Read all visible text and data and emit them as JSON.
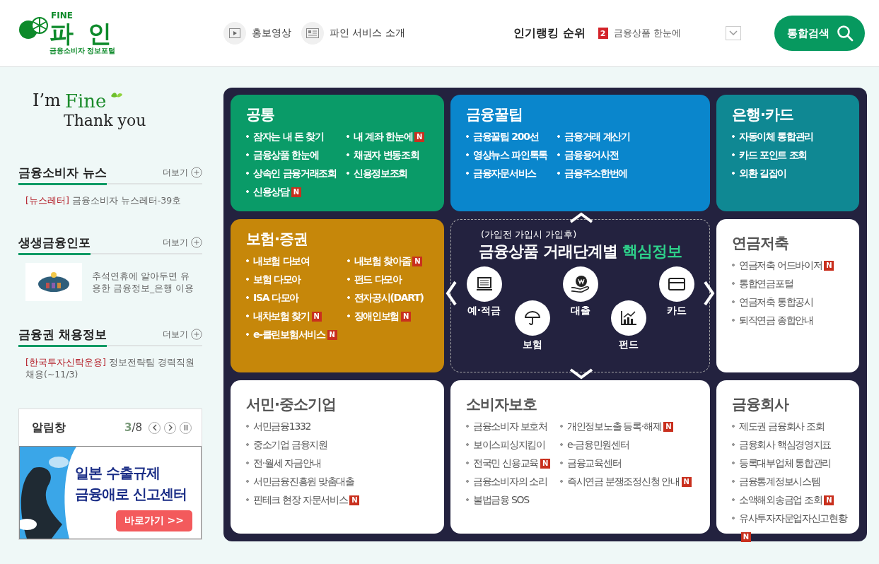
{
  "header": {
    "logo": {
      "top": "FINE",
      "name": "파 인",
      "sub": "금융소비자 정보포털"
    },
    "nav": [
      {
        "label": "홍보영상",
        "kind": "video"
      },
      {
        "label": "파인 서비스 소개",
        "kind": "doc"
      }
    ],
    "ranking": {
      "label": "인기랭킹 순위",
      "rank": "2",
      "text": "금융상품 한눈에"
    },
    "search_button": "통합검색"
  },
  "sidebar": {
    "slogan": {
      "first": "I’m",
      "accent": "Fine",
      "second": "Thank you"
    },
    "sections": [
      {
        "title": "금융소비자 뉴스",
        "more": "더보기",
        "kind": "tagged",
        "tag": "[뉴스레터]",
        "text": "금융소비자 뉴스레터-39호"
      },
      {
        "title": "생생금융인포",
        "more": "더보기",
        "kind": "thumb",
        "text": "추석연휴에 알아두면 유용한 금융정보_은행 이용"
      },
      {
        "title": "금융권 채용정보",
        "more": "더보기",
        "kind": "tagged",
        "tag": "[한국투자신탁운용]",
        "text": "정보전략팀 경력직원 채용(~11/3)"
      }
    ],
    "notice": {
      "title": "알림창",
      "current": "3",
      "total": "/8",
      "banner_lines": [
        "일본 수출규제",
        "금융애로 신고센터"
      ],
      "banner_button": "바로가기 >>"
    }
  },
  "cards": [
    {
      "kind": "list",
      "title": "공통",
      "color": "#0a9b68",
      "columns": [
        [
          {
            "label": "잠자는 내 돈 찾기"
          },
          {
            "label": "금융상품 한눈에"
          },
          {
            "label": "상속인 금융거래조회"
          },
          {
            "label": "신용상담",
            "badge": "N"
          }
        ],
        [
          {
            "label": "내 계좌 한눈에",
            "badge": "N"
          },
          {
            "label": "채권자 변동조회"
          },
          {
            "label": "신용정보조회"
          }
        ]
      ]
    },
    {
      "kind": "list",
      "title": "금융꿀팁",
      "color": "#0a86cc",
      "columns": [
        [
          {
            "label": "금융꿀팁 200선"
          },
          {
            "label": "영상뉴스 파인톡톡"
          },
          {
            "label": "금융자문서비스"
          }
        ],
        [
          {
            "label": "금융거래 계산기"
          },
          {
            "label": "금융용어사전"
          },
          {
            "label": "금융주소한번에"
          }
        ]
      ]
    },
    {
      "kind": "list",
      "title": "은행·카드",
      "color": "#0f8893",
      "columns": [
        [
          {
            "label": "자동이체 통합관리"
          },
          {
            "label": "카드 포인트 조회"
          },
          {
            "label": "외환 길잡이"
          }
        ]
      ]
    },
    {
      "kind": "list",
      "title": "보험·증권",
      "color": "#c6870a",
      "columns": [
        [
          {
            "label": "내보험 다보여"
          },
          {
            "label": "보험 다모아"
          },
          {
            "label": "ISA 다모아"
          },
          {
            "label": "내차보험 찾기",
            "badge": "N"
          },
          {
            "label": "e-클린보험서비스",
            "badge": "N"
          }
        ],
        [
          {
            "label": "내보험 찾아줌",
            "badge": "N"
          },
          {
            "label": "펀드 다모아"
          },
          {
            "label": "전자공시(DART)"
          },
          {
            "label": "장애인보험",
            "badge": "N"
          }
        ]
      ]
    },
    {
      "kind": "steps",
      "subtitle": "(가입전 가입시 가입후)",
      "title": "금융상품 거래단계별",
      "accent": "핵심정보",
      "steps": [
        {
          "label": "예·적금"
        },
        {
          "label": "보험"
        },
        {
          "label": "대출"
        },
        {
          "label": "펀드"
        },
        {
          "label": "카드"
        }
      ]
    },
    {
      "kind": "list",
      "title": "연금저축",
      "color": "#ffffff",
      "columns": [
        [
          {
            "label": "연금저축 어드바이저",
            "badge": "N"
          },
          {
            "label": "통합연금포털"
          },
          {
            "label": "연금저축 통합공시"
          },
          {
            "label": "퇴직연금 종합안내"
          }
        ]
      ]
    },
    {
      "kind": "list",
      "title": "서민·중소기업",
      "color": "#ffffff",
      "columns": [
        [
          {
            "label": "서민금융1332"
          },
          {
            "label": "중소기업 금융지원"
          },
          {
            "label": "전·월세 자금안내"
          },
          {
            "label": "서민금융진흥원 맞춤대출"
          },
          {
            "label": "핀테크 현장 자문서비스",
            "badge": "N"
          }
        ]
      ]
    },
    {
      "kind": "list",
      "title": "소비자보호",
      "color": "#ffffff",
      "columns": [
        [
          {
            "label": "금융소비자 보호처"
          },
          {
            "label": "보이스피싱지킴이"
          },
          {
            "label": "전국민 신용교육",
            "badge": "N"
          },
          {
            "label": "금융소비자의 소리"
          },
          {
            "label": "불법금융 SOS"
          }
        ],
        [
          {
            "label": "개인정보노출 등록·해제",
            "badge": "N"
          },
          {
            "label": "e-금융민원센터"
          },
          {
            "label": "금융교육센터"
          },
          {
            "label": "즉시연금 분쟁조정신청 안내",
            "badge": "N"
          }
        ]
      ]
    },
    {
      "kind": "list",
      "title": "금융회사",
      "color": "#ffffff",
      "columns": [
        [
          {
            "label": "제도권 금융회사 조회"
          },
          {
            "label": "금융회사 핵심경영지표"
          },
          {
            "label": "등록대부업체 통합관리"
          },
          {
            "label": "금융통계정보시스템"
          },
          {
            "label": "소액해외송금업 조회",
            "badge": "N"
          },
          {
            "label": "유사투자자문업자신고현황",
            "badge": "N"
          }
        ]
      ]
    }
  ]
}
